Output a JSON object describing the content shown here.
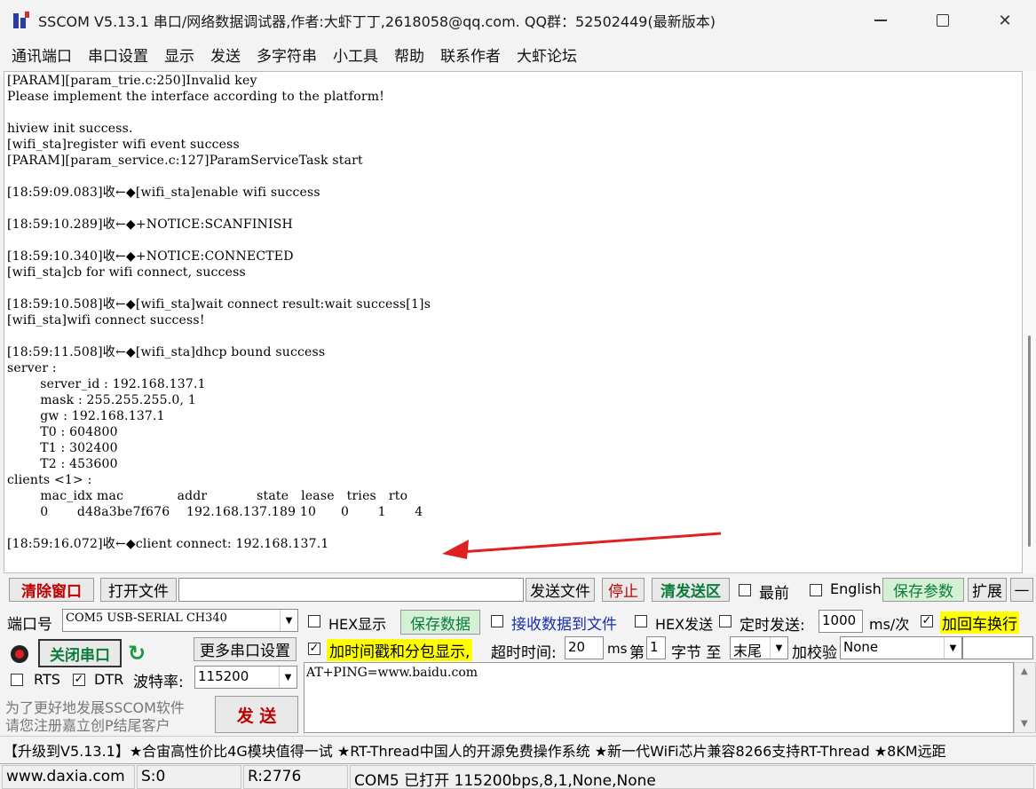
{
  "window": {
    "title": "SSCOM V5.13.1 串口/网络数据调试器,作者:大虾丁丁,2618058@qq.com. QQ群：52502449(最新版本)",
    "minimize_glyph": "—",
    "close_glyph": "✕"
  },
  "menu": [
    "通讯端口",
    "串口设置",
    "显示",
    "发送",
    "多字符串",
    "小工具",
    "帮助",
    "联系作者",
    "大虾论坛"
  ],
  "output_lines": [
    "[PARAM][param_trie.c:250]Invalid key",
    "Please implement the interface according to the platform!",
    "",
    "hiview init success.",
    "[wifi_sta]register wifi event success",
    "[PARAM][param_service.c:127]ParamServiceTask start",
    "",
    "[18:59:09.083]收←◆[wifi_sta]enable wifi success",
    "",
    "[18:59:10.289]收←◆+NOTICE:SCANFINISH",
    "",
    "[18:59:10.340]收←◆+NOTICE:CONNECTED",
    "[wifi_sta]cb for wifi connect, success",
    "",
    "[18:59:10.508]收←◆[wifi_sta]wait connect result:wait success[1]s",
    "[wifi_sta]wifi connect success!",
    "",
    "[18:59:11.508]收←◆[wifi_sta]dhcp bound success",
    "server :",
    "        server_id : 192.168.137.1",
    "        mask : 255.255.255.0, 1",
    "        gw : 192.168.137.1",
    "        T0 : 604800",
    "        T1 : 302400",
    "        T2 : 453600",
    "clients <1> :",
    "        mac_idx mac             addr            state   lease   tries   rto",
    "        0       d48a3be7f676    192.168.137.189 10      0       1       4",
    "",
    "[18:59:16.072]收←◆client connect: 192.168.137.1"
  ],
  "toolbar": {
    "clear_window": "清除窗口",
    "open_file": "打开文件",
    "file_path": "",
    "send_file": "发送文件",
    "stop": "停止",
    "clear_send": "清发送区",
    "topmost": "最前",
    "english": "English",
    "save_params": "保存参数",
    "expand": "扩展",
    "collapse": "—"
  },
  "port": {
    "port_label": "端口号",
    "port_value": "COM5 USB-SERIAL CH340",
    "close_port": "关闭串口",
    "more_settings": "更多串口设置",
    "rts": "RTS",
    "dtr": "DTR",
    "baud_label": "波特率:",
    "baud_value": "115200",
    "promo_line1": "为了更好地发展SSCOM软件",
    "promo_line2": "请您注册嘉立创P结尾客户",
    "send": "发 送"
  },
  "options": {
    "hex_display": "HEX显示",
    "save_data": "保存数据",
    "recv_to_file": "接收数据到文件",
    "hex_send": "HEX发送",
    "timed_send": "定时发送:",
    "interval": "1000",
    "interval_unit": "ms/次",
    "add_crlf": "加回车换行",
    "timestamp": "加时间戳和分包显示,",
    "timeout_label": "超时时间:",
    "timeout_value": "20",
    "ms": "ms",
    "nth": "第",
    "byte_index": "1",
    "byte_label": "字节 至",
    "byte_end": "末尾",
    "checksum_label": "加校验",
    "checksum_value": "None"
  },
  "send_text": "AT+PING=www.baidu.com",
  "marquee": "【升级到V5.13.1】★合宙高性价比4G模块值得一试 ★RT-Thread中国人的开源免费操作系统 ★新一代WiFi芯片兼容8266支持RT-Thread ★8KM远距",
  "status": {
    "website": "www.daxia.com",
    "sent": "S:0",
    "received": "R:2776",
    "port_status": "COM5 已打开  115200bps,8,1,None,None"
  },
  "colors": {
    "arrow": "#e02020",
    "highlight": "#ffff00"
  }
}
